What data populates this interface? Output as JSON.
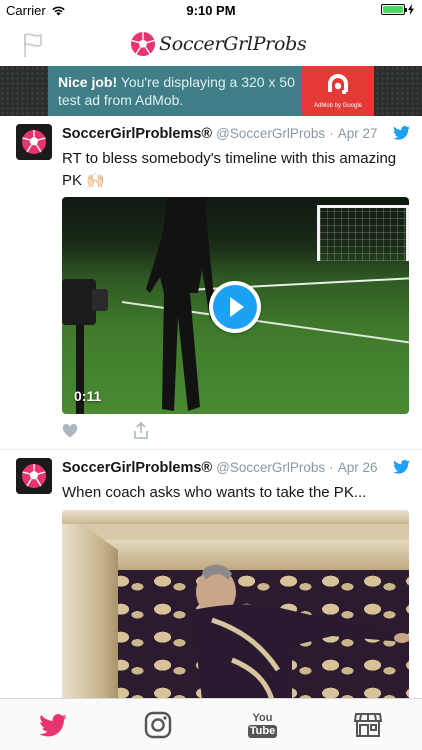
{
  "status_bar": {
    "carrier": "Carrier",
    "time": "9:10 PM",
    "battery_level": 1.0,
    "battery_color": "#4cd964"
  },
  "nav": {
    "left_icon": "flag-icon",
    "brand_name": "SoccerGrlProbs",
    "brand_icon": "soccer-ball-icon"
  },
  "ad": {
    "headline": "Nice job!",
    "body": " You're displaying a 320 x 50 test ad from AdMob.",
    "logo_caption": "AdMob by Google",
    "logo_icon": "admob-logo-icon",
    "background_color": "#3f7e86",
    "logo_color": "#e53935"
  },
  "tweets": [
    {
      "name": "SoccerGirlProblems®",
      "handle": "@SoccerGrlProbs",
      "separator": "·",
      "date": "Apr 27",
      "text": "RT to bless somebody's timeline with this amazing PK 🙌🏻",
      "media_type": "video",
      "duration": "0:11",
      "actions": [
        "heart-icon",
        "share-icon"
      ]
    },
    {
      "name": "SoccerGirlProblems®",
      "handle": "@SoccerGrlProbs",
      "separator": "·",
      "date": "Apr 26",
      "text": "When coach asks who wants to take the PK...",
      "media_type": "image"
    }
  ],
  "tab_bar": {
    "tabs": [
      {
        "name": "twitter",
        "icon": "twitter-bird-icon",
        "active": true
      },
      {
        "name": "instagram",
        "icon": "instagram-icon",
        "active": false
      },
      {
        "name": "youtube",
        "icon": "youtube-icon",
        "label_top": "You",
        "label_bottom": "Tube",
        "active": false
      },
      {
        "name": "store",
        "icon": "store-icon",
        "active": false
      }
    ],
    "active_color": "#e8336e",
    "inactive_color": "#555555"
  },
  "colors": {
    "twitter_blue": "#1da1f2",
    "text_primary": "#14171a",
    "text_secondary": "#8899a6"
  }
}
